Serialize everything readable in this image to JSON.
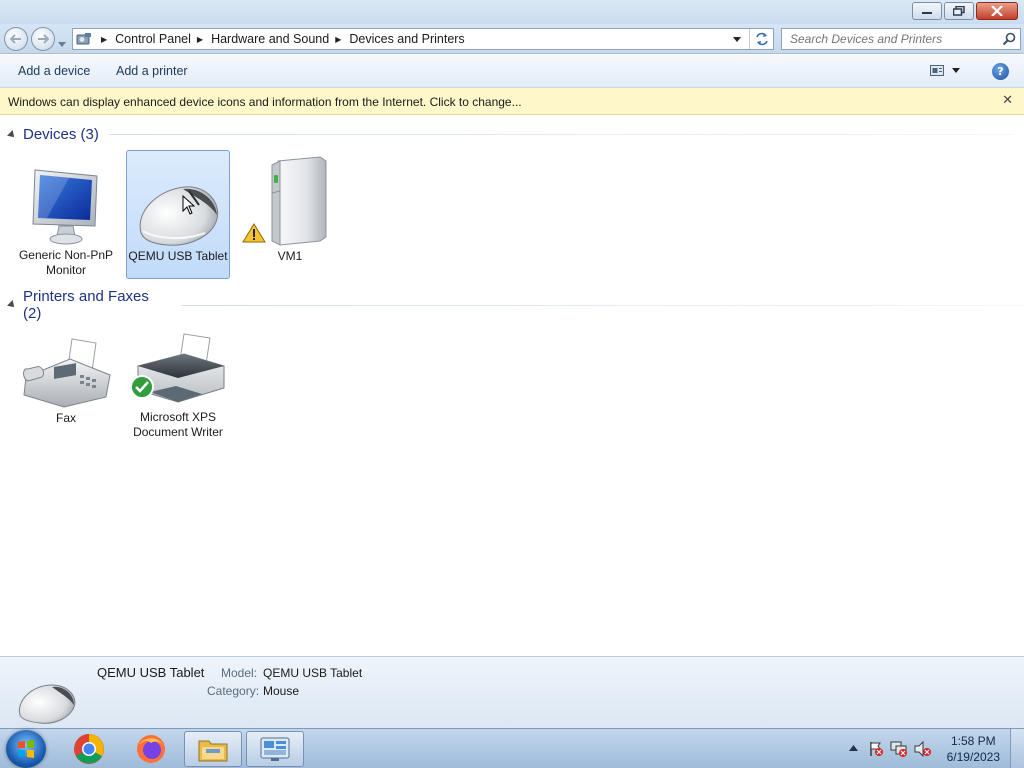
{
  "window": {
    "title": "Devices and Printers"
  },
  "address": {
    "breadcrumbs": [
      "Control Panel",
      "Hardware and Sound",
      "Devices and Printers"
    ],
    "search_placeholder": "Search Devices and Printers"
  },
  "commandbar": {
    "add_device": "Add a device",
    "add_printer": "Add a printer"
  },
  "infobar": {
    "text": "Windows can display enhanced device icons and information from the Internet. Click to change..."
  },
  "groups": {
    "devices": {
      "title": "Devices (3)",
      "items": [
        {
          "label": "Generic Non-PnP Monitor",
          "icon": "monitor-icon",
          "selected": false
        },
        {
          "label": "QEMU USB Tablet",
          "icon": "mouse-icon",
          "selected": true
        },
        {
          "label": "VM1",
          "icon": "computer-tower-icon",
          "warning": true,
          "selected": false
        }
      ]
    },
    "printers": {
      "title": "Printers and Faxes (2)",
      "items": [
        {
          "label": "Fax",
          "icon": "fax-icon"
        },
        {
          "label": "Microsoft XPS Document Writer",
          "icon": "printer-icon",
          "default": true
        }
      ]
    }
  },
  "details": {
    "name": "QEMU USB Tablet",
    "model_label": "Model:",
    "model_value": "QEMU USB Tablet",
    "category_label": "Category:",
    "category_value": "Mouse"
  },
  "taskbar": {
    "apps": [
      "windows-explorer",
      "chrome",
      "firefox",
      "file-explorer",
      "control-panel"
    ],
    "time": "1:58 PM",
    "date": "6/19/2023"
  },
  "colors": {
    "group_title": "#1e3287",
    "infobar_bg": "#fdf7c9",
    "selection_bg": "#c1dbfa"
  }
}
